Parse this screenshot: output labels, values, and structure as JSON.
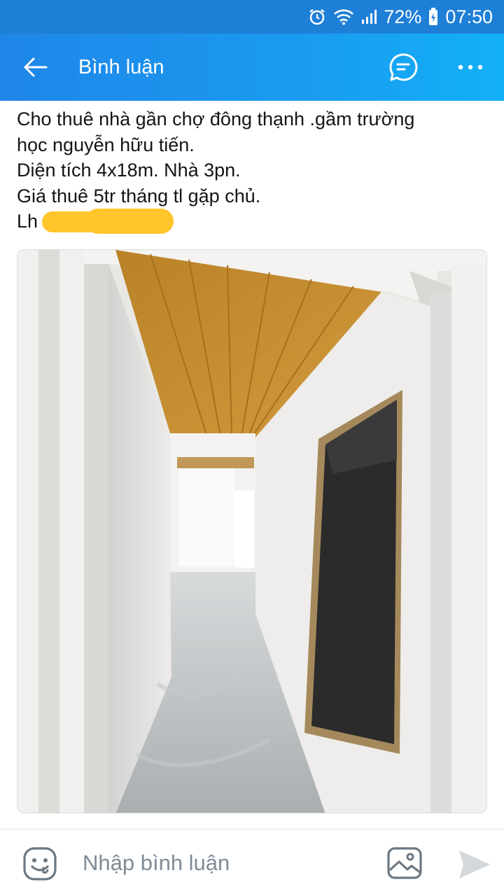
{
  "status_bar": {
    "battery": "72%",
    "time": "07:50",
    "icons": [
      "alarm-icon",
      "wifi-icon",
      "signal-icon",
      "battery-icon"
    ]
  },
  "header": {
    "title": "Bình luận",
    "back_icon": "arrow-left-icon",
    "chat_icon": "chat-bubble-icon",
    "more_icon": "more-horizontal-icon",
    "accent": "#1a9bf0"
  },
  "post": {
    "lines": [
      "Cho thuê nhà gần chợ đông thạnh .gầm trường",
      "học nguyễn hữu tiến.",
      "Diện tích 4x18m. Nhà 3pn.",
      "Giá thuê 5tr tháng tl gặp chủ."
    ],
    "contact_prefix": "Lh",
    "phone_color": "#1a8fe6",
    "photo_icon": "photo-of-hallway"
  },
  "composer": {
    "placeholder": "Nhập bình luận",
    "emoji_icon": "sticker-smile-icon",
    "image_icon": "image-icon",
    "send_icon": "send-icon"
  }
}
